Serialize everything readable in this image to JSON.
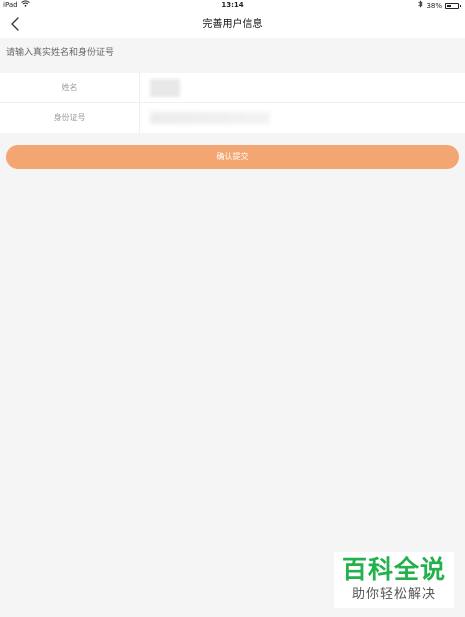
{
  "status_bar": {
    "device": "iPad",
    "time": "13:14",
    "battery_percent": "38%",
    "battery_level": 0.38,
    "icons": [
      "wifi-icon",
      "bluetooth-icon",
      "battery-icon"
    ]
  },
  "nav": {
    "title": "完善用户信息",
    "back_icon": "chevron-left-icon"
  },
  "form": {
    "hint": "请输入真实姓名和身份证号",
    "fields": [
      {
        "label": "姓名",
        "value": "",
        "placeholder": ""
      },
      {
        "label": "身份证号",
        "value": "",
        "placeholder": ""
      }
    ]
  },
  "submit": {
    "label": "确认提交"
  },
  "colors": {
    "accent": "#f4a672",
    "background": "#f5f5f5",
    "watermark_green": "#22b14c"
  },
  "watermark": {
    "title": "百科全说",
    "subtitle": "助你轻松解决"
  }
}
